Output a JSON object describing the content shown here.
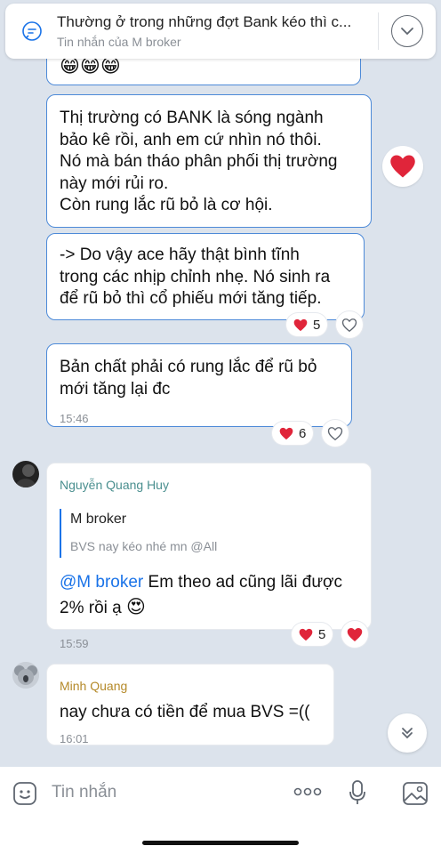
{
  "pinned": {
    "title": "Thường ở trong những đợt Bank kéo thì c...",
    "subtitle": "Tin nhắn của M broker"
  },
  "messages": {
    "m1": {
      "text": "Thị trường có BANK là sóng ngành\nbảo kê rồi, anh em cứ nhìn nó thôi.\nNó mà bán tháo phân phối thị trường\nnày mới rủi ro.\nCòn rung lắc rũ bỏ là cơ hội."
    },
    "m2": {
      "text": "-> Do vậy ace hãy thật bình tĩnh\ntrong các nhịp chỉnh nhẹ. Nó sinh ra\nđể rũ bỏ thì cổ phiếu mới tăng tiếp.",
      "reaction_count": "5"
    },
    "m3": {
      "text": "Bản chất phải có rung lắc để rũ bỏ\nmới tăng lại đc",
      "time": "15:46",
      "reaction_count": "6"
    },
    "m4": {
      "sender": "Nguyễn Quang Huy",
      "reply_name": "M broker",
      "reply_text": "BVS nay kéo nhé mn @All",
      "mention": "@M broker",
      "text_line1": " Em theo ad cũng lãi được",
      "text_line2": "2% rồi ạ ",
      "emoji": "😍",
      "time": "15:59",
      "reaction_count": "5"
    },
    "m5": {
      "sender": "Minh Quang",
      "text": "nay chưa có tiền để mua BVS =((",
      "time": "16:01"
    }
  },
  "composer": {
    "placeholder": "Tin nhắn"
  },
  "colors": {
    "accent": "#1a73e8",
    "heart": "#e0253a",
    "bubble_border": "#4d8ad8",
    "background": "#dce3ec"
  }
}
